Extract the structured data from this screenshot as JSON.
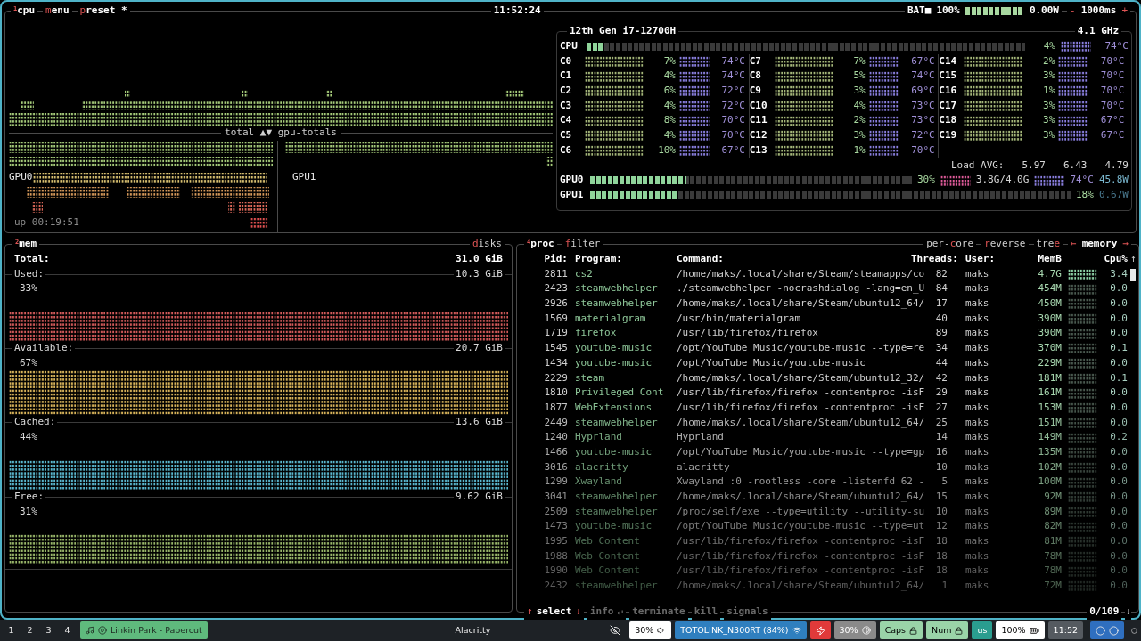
{
  "cpu_box": {
    "tabs": [
      {
        "index": "1",
        "label": "cpu"
      },
      {
        "hotkey": "m",
        "label": "enu"
      },
      {
        "hotkey": "p",
        "label": "reset *"
      }
    ],
    "clock": "11:52:24",
    "battery": {
      "label": "BAT■",
      "percent": "100%",
      "level": 1.0,
      "power": "0.00W"
    },
    "interval": {
      "minus": "-",
      "value": "1000ms",
      "plus": "+"
    },
    "graph_label": "total ▲▼ gpu-totals",
    "gpu_graph_labels": [
      "GPU0",
      "GPU1"
    ],
    "uptime": "up 00:19:51",
    "cpu_name": "12th Gen i7-12700H",
    "frequency": "4.1 GHz",
    "total": {
      "label": "CPU",
      "level": 0.04,
      "percent": "4%",
      "temp": "74°C"
    },
    "cores": [
      {
        "label": "C0",
        "percent": "7%",
        "temp": "74°C"
      },
      {
        "label": "C1",
        "percent": "4%",
        "temp": "74°C"
      },
      {
        "label": "C2",
        "percent": "6%",
        "temp": "72°C"
      },
      {
        "label": "C3",
        "percent": "4%",
        "temp": "72°C"
      },
      {
        "label": "C4",
        "percent": "8%",
        "temp": "70°C"
      },
      {
        "label": "C5",
        "percent": "4%",
        "temp": "70°C"
      },
      {
        "label": "C6",
        "percent": "10%",
        "temp": "67°C"
      },
      {
        "label": "C7",
        "percent": "7%",
        "temp": "67°C"
      },
      {
        "label": "C8",
        "percent": "5%",
        "temp": "74°C"
      },
      {
        "label": "C9",
        "percent": "3%",
        "temp": "69°C"
      },
      {
        "label": "C10",
        "percent": "4%",
        "temp": "73°C"
      },
      {
        "label": "C11",
        "percent": "2%",
        "temp": "73°C"
      },
      {
        "label": "C12",
        "percent": "3%",
        "temp": "72°C"
      },
      {
        "label": "C13",
        "percent": "1%",
        "temp": "70°C"
      },
      {
        "label": "C14",
        "percent": "2%",
        "temp": "70°C"
      },
      {
        "label": "C15",
        "percent": "3%",
        "temp": "70°C"
      },
      {
        "label": "C16",
        "percent": "1%",
        "temp": "70°C"
      },
      {
        "label": "C17",
        "percent": "3%",
        "temp": "70°C"
      },
      {
        "label": "C18",
        "percent": "3%",
        "temp": "67°C"
      },
      {
        "label": "C19",
        "percent": "3%",
        "temp": "67°C"
      }
    ],
    "load_avg": {
      "label": "Load AVG:",
      "values": [
        "5.97",
        "6.43",
        "4.79"
      ]
    },
    "gpus": [
      {
        "label": "GPU0",
        "level": 0.3,
        "percent": "30%",
        "memory": "3.8G/4.0G",
        "temp": "74°C",
        "power": "45.8W"
      },
      {
        "label": "GPU1",
        "level": 0.18,
        "percent": "18%",
        "power": "0.67W"
      }
    ]
  },
  "mem_box": {
    "tab": {
      "index": "2",
      "label": "mem"
    },
    "disks_tab": {
      "hotkey": "d",
      "label": "isks"
    },
    "total": {
      "label": "Total:",
      "value": "31.0 GiB"
    },
    "sections": [
      {
        "label": "Used:",
        "value": "10.3 GiB",
        "percent": "33%",
        "color": "#d45a5a"
      },
      {
        "label": "Available:",
        "value": "20.7 GiB",
        "percent": "67%",
        "color": "#d9b45a"
      },
      {
        "label": "Cached:",
        "value": "13.6 GiB",
        "percent": "44%",
        "color": "#5ab8d0"
      },
      {
        "label": "Free:",
        "value": "9.62 GiB",
        "percent": "31%",
        "color": "#9ab86a"
      }
    ]
  },
  "proc_box": {
    "tab": {
      "index": "4",
      "label": "proc"
    },
    "left_tabs": [
      {
        "hotkey": "f",
        "after": "ilter"
      }
    ],
    "right_tabs": [
      {
        "before": "per-",
        "hotkey": "c",
        "after": "ore"
      },
      {
        "hotkey": "r",
        "after": "everse"
      },
      {
        "before": "tre",
        "hotkey": "e"
      }
    ],
    "sort": {
      "left": "←",
      "label": "memory",
      "right": "→"
    },
    "columns": [
      "Pid:",
      "Program:",
      "Command:",
      "Threads:",
      "User:",
      "MemB",
      "Cpu%"
    ],
    "scroll_up": "↑",
    "scroll_down": "↓",
    "rows": [
      {
        "pid": "2811",
        "program": "cs2",
        "command": "/home/maks/.local/share/Steam/steamapps/co",
        "threads": "82",
        "user": "maks",
        "mem": "4.7G",
        "cpu": "3.4"
      },
      {
        "pid": "2423",
        "program": "steamwebhelper",
        "command": "./steamwebhelper -nocrashdialog -lang=en_U",
        "threads": "84",
        "user": "maks",
        "mem": "454M",
        "cpu": "0.0"
      },
      {
        "pid": "2926",
        "program": "steamwebhelper",
        "command": "/home/maks/.local/share/Steam/ubuntu12_64/",
        "threads": "17",
        "user": "maks",
        "mem": "450M",
        "cpu": "0.0"
      },
      {
        "pid": "1569",
        "program": "materialgram",
        "command": "/usr/bin/materialgram",
        "threads": "40",
        "user": "maks",
        "mem": "390M",
        "cpu": "0.0"
      },
      {
        "pid": "1719",
        "program": "firefox",
        "command": "/usr/lib/firefox/firefox",
        "threads": "89",
        "user": "maks",
        "mem": "390M",
        "cpu": "0.0"
      },
      {
        "pid": "1545",
        "program": "youtube-music",
        "command": "/opt/YouTube Music/youtube-music --type=re",
        "threads": "34",
        "user": "maks",
        "mem": "370M",
        "cpu": "0.1"
      },
      {
        "pid": "1434",
        "program": "youtube-music",
        "command": "/opt/YouTube Music/youtube-music",
        "threads": "44",
        "user": "maks",
        "mem": "229M",
        "cpu": "0.0"
      },
      {
        "pid": "2229",
        "program": "steam",
        "command": "/home/maks/.local/share/Steam/ubuntu12_32/",
        "threads": "42",
        "user": "maks",
        "mem": "181M",
        "cpu": "0.1"
      },
      {
        "pid": "1810",
        "program": "Privileged Cont",
        "command": "/usr/lib/firefox/firefox -contentproc -isF",
        "threads": "29",
        "user": "maks",
        "mem": "161M",
        "cpu": "0.0"
      },
      {
        "pid": "1877",
        "program": "WebExtensions",
        "command": "/usr/lib/firefox/firefox -contentproc -isF",
        "threads": "27",
        "user": "maks",
        "mem": "153M",
        "cpu": "0.0"
      },
      {
        "pid": "2449",
        "program": "steamwebhelper",
        "command": "/home/maks/.local/share/Steam/ubuntu12_64/",
        "threads": "25",
        "user": "maks",
        "mem": "151M",
        "cpu": "0.0"
      },
      {
        "pid": "1240",
        "program": "Hyprland",
        "command": "Hyprland",
        "threads": "14",
        "user": "maks",
        "mem": "149M",
        "cpu": "0.2"
      },
      {
        "pid": "1466",
        "program": "youtube-music",
        "command": "/opt/YouTube Music/youtube-music --type=gp",
        "threads": "16",
        "user": "maks",
        "mem": "135M",
        "cpu": "0.0"
      },
      {
        "pid": "3016",
        "program": "alacritty",
        "command": "alacritty",
        "threads": "10",
        "user": "maks",
        "mem": "102M",
        "cpu": "0.0"
      },
      {
        "pid": "1299",
        "program": "Xwayland",
        "command": "Xwayland :0 -rootless -core -listenfd 62 -",
        "threads": "5",
        "user": "maks",
        "mem": "100M",
        "cpu": "0.0"
      },
      {
        "pid": "3041",
        "program": "steamwebhelper",
        "command": "/home/maks/.local/share/Steam/ubuntu12_64/",
        "threads": "15",
        "user": "maks",
        "mem": "92M",
        "cpu": "0.0"
      },
      {
        "pid": "2509",
        "program": "steamwebhelper",
        "command": "/proc/self/exe --type=utility --utility-su",
        "threads": "10",
        "user": "maks",
        "mem": "89M",
        "cpu": "0.0"
      },
      {
        "pid": "1473",
        "program": "youtube-music",
        "command": "/opt/YouTube Music/youtube-music --type=ut",
        "threads": "12",
        "user": "maks",
        "mem": "82M",
        "cpu": "0.0"
      },
      {
        "pid": "1995",
        "program": "Web Content",
        "command": "/usr/lib/firefox/firefox -contentproc -isF",
        "threads": "18",
        "user": "maks",
        "mem": "81M",
        "cpu": "0.0"
      },
      {
        "pid": "1988",
        "program": "Web Content",
        "command": "/usr/lib/firefox/firefox -contentproc -isF",
        "threads": "18",
        "user": "maks",
        "mem": "78M",
        "cpu": "0.0"
      },
      {
        "pid": "1990",
        "program": "Web Content",
        "command": "/usr/lib/firefox/firefox -contentproc -isF",
        "threads": "18",
        "user": "maks",
        "mem": "78M",
        "cpu": "0.0"
      },
      {
        "pid": "2432",
        "program": "steamwebhelper",
        "command": "/home/maks/.local/share/Steam/ubuntu12_64/",
        "threads": "1",
        "user": "maks",
        "mem": "72M",
        "cpu": "0.0"
      }
    ],
    "footer": {
      "up": "↑",
      "select": "select",
      "down": "↓",
      "actions": [
        {
          "label": "info",
          "key": "↵"
        },
        {
          "label": "terminate"
        },
        {
          "label": "kill"
        },
        {
          "label": "signals"
        }
      ],
      "count": "0/109"
    }
  },
  "taskbar": {
    "workspaces": [
      "1",
      "2",
      "3",
      "4"
    ],
    "media": "Linkin Park - Papercut",
    "window_title": "Alacritty",
    "volume": "30%",
    "wifi": "TOTOLINK_N300RT (84%)",
    "brightness": "30%",
    "caps": "Caps",
    "num": "Num",
    "layout": "us",
    "battery": "100%",
    "time": "11:52"
  }
}
